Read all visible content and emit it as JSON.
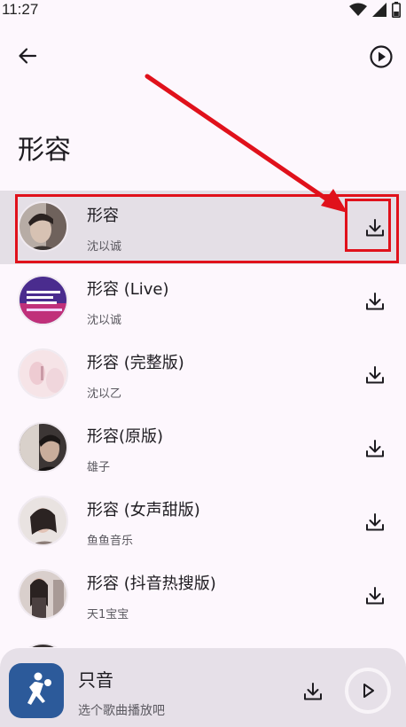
{
  "status": {
    "time": "11:27"
  },
  "header": {
    "back_icon": "arrow-back-icon",
    "play_all_icon": "play-circle-icon"
  },
  "page": {
    "title": "形容"
  },
  "songs": [
    {
      "title": "形容",
      "artist": "沈以诚",
      "selected": true
    },
    {
      "title": "形容 (Live)",
      "artist": "沈以诚",
      "selected": false
    },
    {
      "title": "形容 (完整版)",
      "artist": "沈以乙",
      "selected": false
    },
    {
      "title": "形容(原版)",
      "artist": "雄子",
      "selected": false
    },
    {
      "title": "形容 (女声甜版)",
      "artist": "鱼鱼音乐",
      "selected": false
    },
    {
      "title": "形容 (抖音热搜版)",
      "artist": "天1宝宝",
      "selected": false
    },
    {
      "title": "",
      "artist": "",
      "selected": false
    }
  ],
  "player": {
    "title": "只音",
    "subtitle": "选个歌曲播放吧"
  },
  "colors": {
    "background": "#fdf7fd",
    "selected_row": "#e4dfe6",
    "annotation_red": "#e0111b",
    "player_bar": "#e6e0e8",
    "app_icon_bg": "#2c5a9a"
  }
}
